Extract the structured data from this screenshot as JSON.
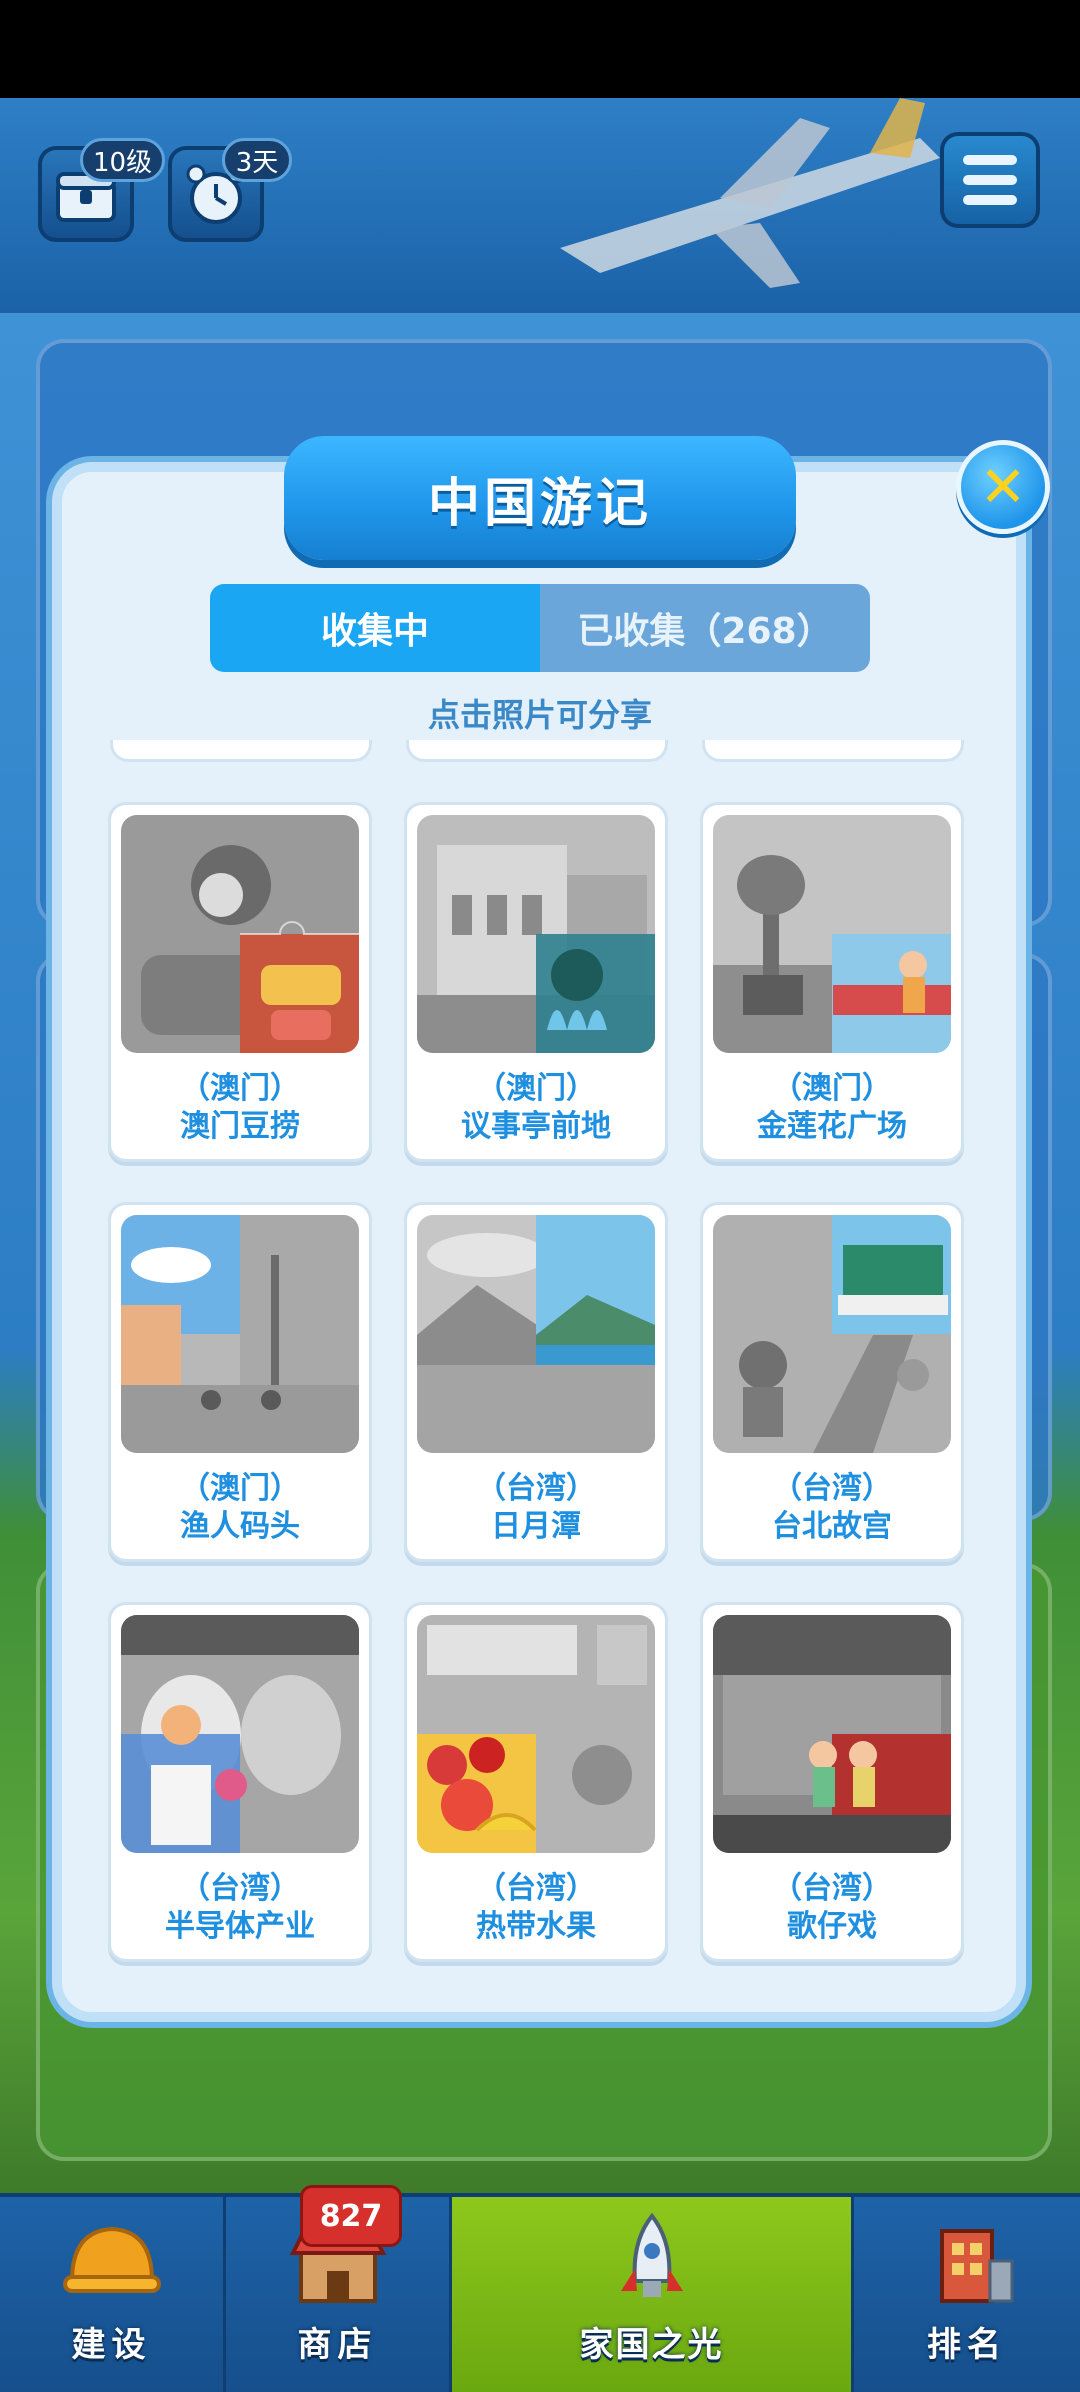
{
  "hud": {
    "level_badge": "10级",
    "days_badge": "3天"
  },
  "dialog": {
    "title": "中国游记",
    "close_icon": "close-x-icon",
    "tabs": [
      {
        "label": "收集中",
        "active": true
      },
      {
        "label": "已收集（268）",
        "active": false
      }
    ],
    "hint": "点击照片可分享",
    "cards": [
      {
        "region": "（澳门）",
        "name": "澳门豆捞"
      },
      {
        "region": "（澳门）",
        "name": "议事亭前地"
      },
      {
        "region": "（澳门）",
        "name": "金莲花广场"
      },
      {
        "region": "（澳门）",
        "name": "渔人码头"
      },
      {
        "region": "（台湾）",
        "name": "日月潭"
      },
      {
        "region": "（台湾）",
        "name": "台北故宫"
      },
      {
        "region": "（台湾）",
        "name": "半导体产业"
      },
      {
        "region": "（台湾）",
        "name": "热带水果"
      },
      {
        "region": "（台湾）",
        "name": "歌仔戏"
      }
    ]
  },
  "bottom_nav": {
    "items": [
      {
        "label": "建设",
        "icon": "hardhat-icon"
      },
      {
        "label": "商店",
        "icon": "shop-icon",
        "badge": "827"
      },
      {
        "label": "家国之光",
        "icon": "rocket-icon",
        "active": true
      },
      {
        "label": "排名",
        "icon": "building-icon"
      }
    ]
  },
  "colors": {
    "accent": "#1aa6f2",
    "card_text": "#1f8fe0",
    "badge_red": "#d6302c",
    "active_nav": "#8ec81d"
  }
}
